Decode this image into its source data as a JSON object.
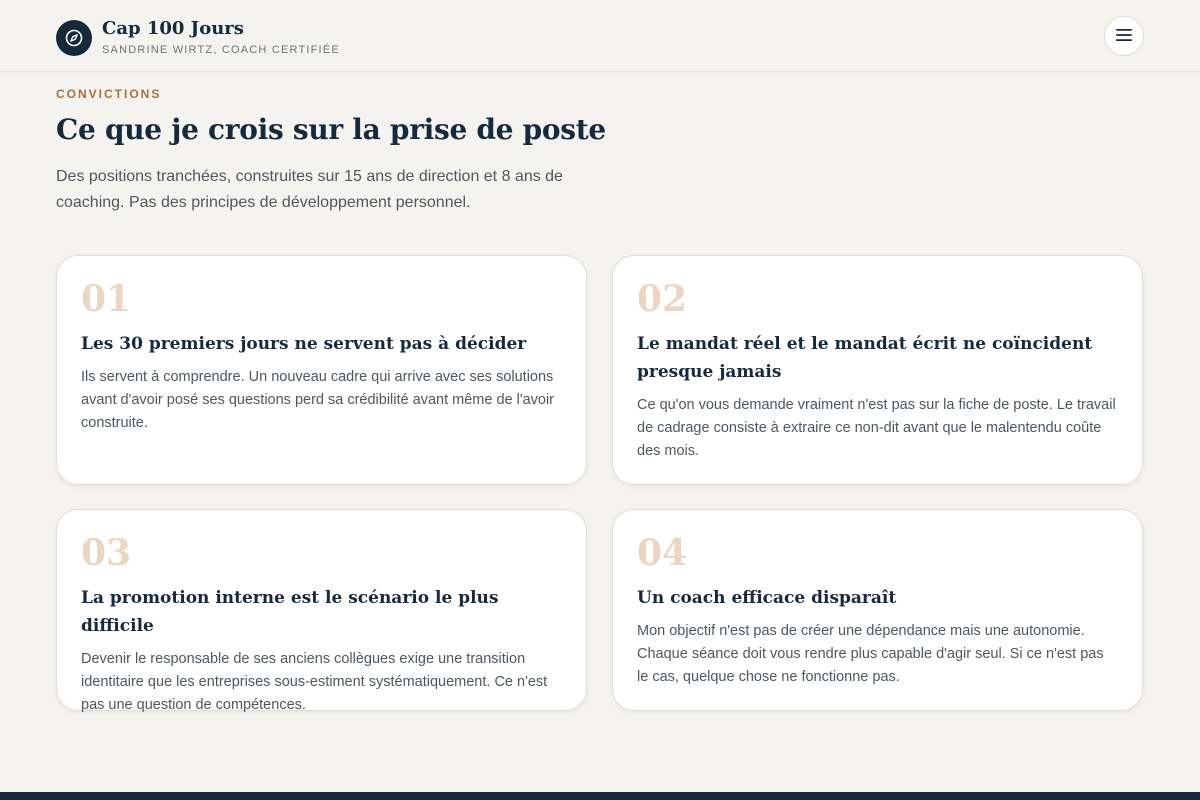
{
  "header": {
    "brand_title": "Cap 100 Jours",
    "brand_subtitle": "SANDRINE WIRTZ, COACH CERTIFIÉE",
    "logo_icon": "compass-icon",
    "menu_icon": "hamburger-menu-icon"
  },
  "section": {
    "eyebrow": "CONVICTIONS",
    "title": "Ce que je crois sur la prise de poste",
    "lead": "Des positions tranchées, construites sur 15 ans de direction et 8 ans de coaching. Pas des principes de développement personnel."
  },
  "cards": [
    {
      "number": "01",
      "title": "Les 30 premiers jours ne servent pas à décider",
      "body": "Ils servent à comprendre. Un nouveau cadre qui arrive avec ses solutions avant d'avoir posé ses questions perd sa crédibilité avant même de l'avoir construite."
    },
    {
      "number": "02",
      "title": "Le mandat réel et le mandat écrit ne coïncident presque jamais",
      "body": "Ce qu'on vous demande vraiment n'est pas sur la fiche de poste. Le travail de cadrage consiste à extraire ce non-dit avant que le malentendu coûte des mois."
    },
    {
      "number": "03",
      "title": "La promotion interne est le scénario le plus difficile",
      "body": "Devenir le responsable de ses anciens collègues exige une transition identitaire que les entreprises sous-estiment systématiquement. Ce n'est pas une question de compétences."
    },
    {
      "number": "04",
      "title": "Un coach efficace disparaît",
      "body": "Mon objectif n'est pas de créer une dépendance mais une autonomie. Chaque séance doit vous rendre plus capable d'agir seul. Si ce n'est pas le cas, quelque chose ne fonctionne pas."
    }
  ],
  "colors": {
    "navy": "#15293b",
    "accent": "#a8703c",
    "number": "#ead6c2",
    "background": "#f5f3ef"
  }
}
